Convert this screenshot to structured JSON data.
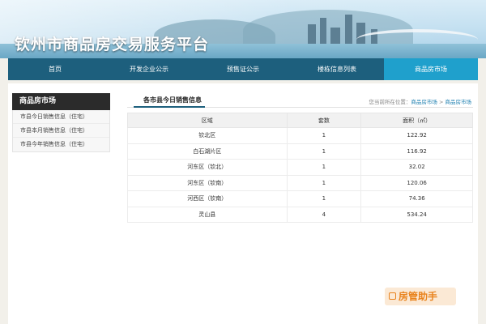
{
  "header": {
    "site_title": "钦州市商品房交易服务平台"
  },
  "nav": {
    "items": [
      {
        "label": "首页",
        "active": false
      },
      {
        "label": "开发企业公示",
        "active": false
      },
      {
        "label": "预售证公示",
        "active": false
      },
      {
        "label": "楼栋信息列表",
        "active": false
      },
      {
        "label": "商品房市场",
        "active": true
      }
    ]
  },
  "sidebar": {
    "title": "商品房市场",
    "items": [
      {
        "label": "市县今日销售信息（住宅）"
      },
      {
        "label": "市县本月销售信息（住宅）"
      },
      {
        "label": "市县今年销售信息（住宅）"
      }
    ]
  },
  "main": {
    "title": "各市县今日销售信息",
    "breadcrumb": {
      "prefix": "您当前所在位置：",
      "first": "商品房市场",
      "separator": ">",
      "second": "商品房市场"
    },
    "table": {
      "headers": [
        "区域",
        "套数",
        "面积（㎡）"
      ],
      "rows": [
        [
          "钦北区",
          "1",
          "122.92"
        ],
        [
          "白石湖片区",
          "1",
          "116.92"
        ],
        [
          "河东区（钦北）",
          "1",
          "32.02"
        ],
        [
          "河东区（钦南）",
          "1",
          "120.06"
        ],
        [
          "河西区（钦南）",
          "1",
          "74.36"
        ],
        [
          "灵山县",
          "4",
          "534.24"
        ]
      ]
    }
  },
  "watermark": {
    "text": "房管助手",
    "color": "#e9831e"
  },
  "colors": {
    "nav_bg": "#1d5f7d",
    "nav_active": "#1fa0cc",
    "link": "#1d7fb0"
  }
}
